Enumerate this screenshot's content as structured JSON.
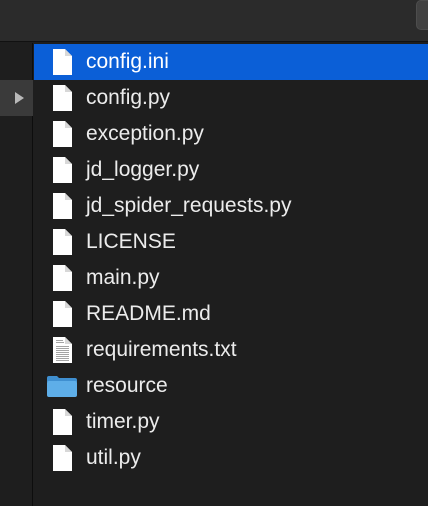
{
  "files": [
    {
      "name": "config.ini",
      "icon": "document-icon",
      "selected": true
    },
    {
      "name": "config.py",
      "icon": "document-icon",
      "selected": false
    },
    {
      "name": "exception.py",
      "icon": "document-icon",
      "selected": false
    },
    {
      "name": "jd_logger.py",
      "icon": "document-icon",
      "selected": false
    },
    {
      "name": "jd_spider_requests.py",
      "icon": "document-icon",
      "selected": false
    },
    {
      "name": "LICENSE",
      "icon": "document-icon",
      "selected": false
    },
    {
      "name": "main.py",
      "icon": "document-icon",
      "selected": false
    },
    {
      "name": "README.md",
      "icon": "document-icon",
      "selected": false
    },
    {
      "name": "requirements.txt",
      "icon": "text-document-icon",
      "selected": false
    },
    {
      "name": "resource",
      "icon": "folder-icon",
      "selected": false
    },
    {
      "name": "timer.py",
      "icon": "document-icon",
      "selected": false
    },
    {
      "name": "util.py",
      "icon": "document-icon",
      "selected": false
    }
  ],
  "colors": {
    "selection": "#0b5fd7",
    "background": "#1e1e1e",
    "text": "#ececec",
    "folder": "#5eaee8"
  }
}
